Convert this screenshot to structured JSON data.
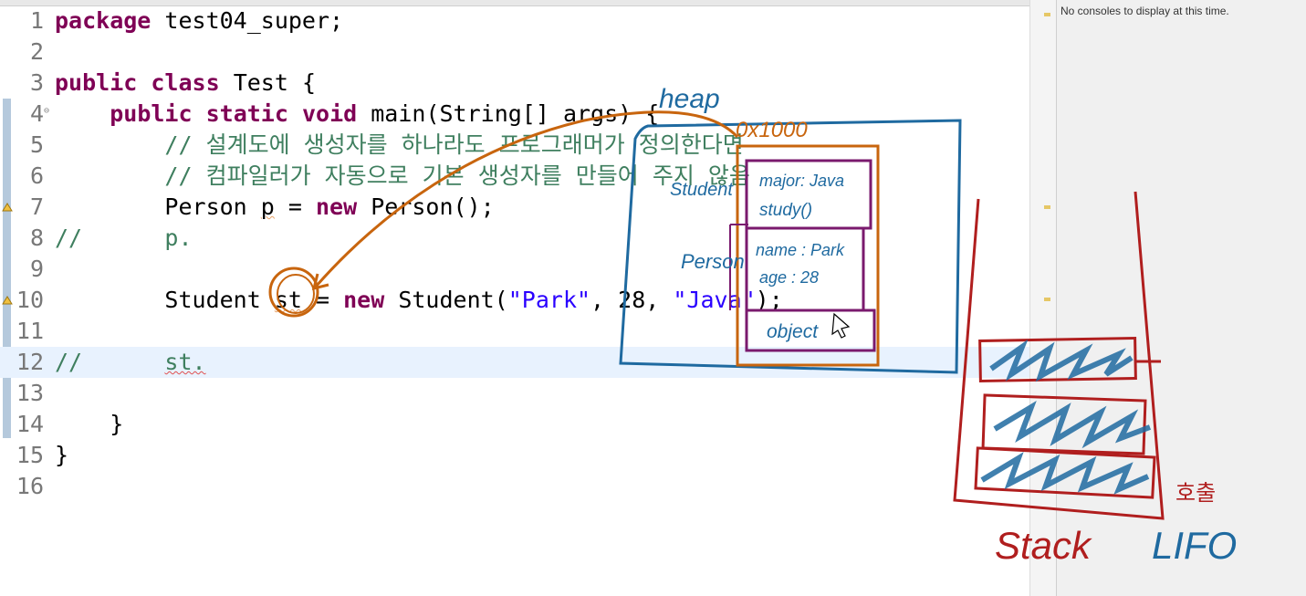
{
  "editor": {
    "lines": [
      {
        "num": "1"
      },
      {
        "num": "2"
      },
      {
        "num": "3"
      },
      {
        "num": "4"
      },
      {
        "num": "5"
      },
      {
        "num": "6"
      },
      {
        "num": "7"
      },
      {
        "num": "8"
      },
      {
        "num": "9"
      },
      {
        "num": "10"
      },
      {
        "num": "11"
      },
      {
        "num": "12"
      },
      {
        "num": "13"
      },
      {
        "num": "14"
      },
      {
        "num": "15"
      },
      {
        "num": "16"
      }
    ],
    "tokens": {
      "l1_kw": "package",
      "l1_rest": " test04_super;",
      "l3_kw1": "public",
      "l3_kw2": "class",
      "l3_rest": " Test {",
      "l4_kw1": "public",
      "l4_kw2": "static",
      "l4_kw3": "void",
      "l4_rest": " main(String[] args) {",
      "l5_comment": "// 설계도에 생성자를 하나라도 프로그래머가 정의한다면",
      "l6_comment": "// 컴파일러가 자동으로 기본 생성자를 만들어 주지 않음",
      "l7_a": "Person ",
      "l7_var": "p",
      "l7_b": " = ",
      "l7_kw": "new",
      "l7_c": " Person();",
      "l8_comment": "//",
      "l8_code": "p.",
      "l10_a": "Student ",
      "l10_var": "st",
      "l10_b": " = ",
      "l10_kw": "new",
      "l10_c": " Student(",
      "l10_s1": "\"Park\"",
      "l10_d": ", 28, ",
      "l10_s2": "\"Java\"",
      "l10_e": ");",
      "l12_comment": "//",
      "l12_code": "st.",
      "l14_brace": "}",
      "l15_brace": "}"
    }
  },
  "console": {
    "message": "No consoles to display at this time."
  },
  "annotations": {
    "heap": "heap",
    "address": "0x1000",
    "student": "Student",
    "person": "Person",
    "major": "major: Java",
    "study": "study()",
    "name": "name : Park",
    "age": "age : 28",
    "object": "object",
    "stack": "Stack",
    "lifo": "LIFO",
    "call": "호출"
  },
  "colors": {
    "keyword": "#7f0055",
    "comment": "#3f7f5f",
    "string": "#2a00ff",
    "ink_orange": "#c8650e",
    "ink_blue": "#1f6aa0",
    "ink_purple": "#7a1a6e",
    "ink_red": "#b01e1e"
  }
}
